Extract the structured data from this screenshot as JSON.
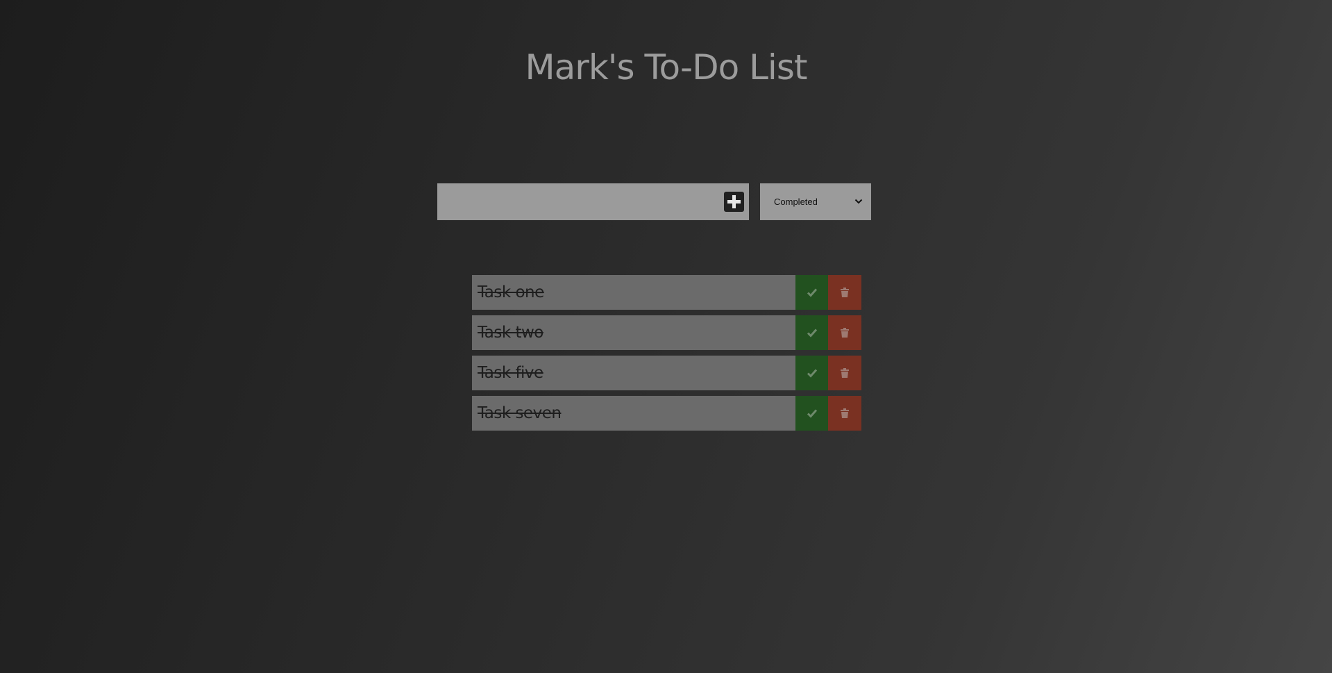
{
  "header": {
    "title": "Mark's To-Do List"
  },
  "form": {
    "input_value": "",
    "add_icon": "plus-square-icon",
    "filter": {
      "selected": "Completed",
      "icon": "chevron-down-icon"
    }
  },
  "todos": [
    {
      "text": "Task one",
      "completed": true
    },
    {
      "text": "Task two",
      "completed": true
    },
    {
      "text": "Task five",
      "completed": true
    },
    {
      "text": "Task seven",
      "completed": true
    }
  ],
  "icons": {
    "complete": "check-icon",
    "delete": "trash-icon"
  },
  "colors": {
    "background": "#2b2b2b",
    "title": "#9c9c9c",
    "input_bg": "#9b9b9b",
    "item_bg": "#6b6b6b",
    "complete_bg": "#22511f",
    "delete_bg": "#7a3122"
  }
}
